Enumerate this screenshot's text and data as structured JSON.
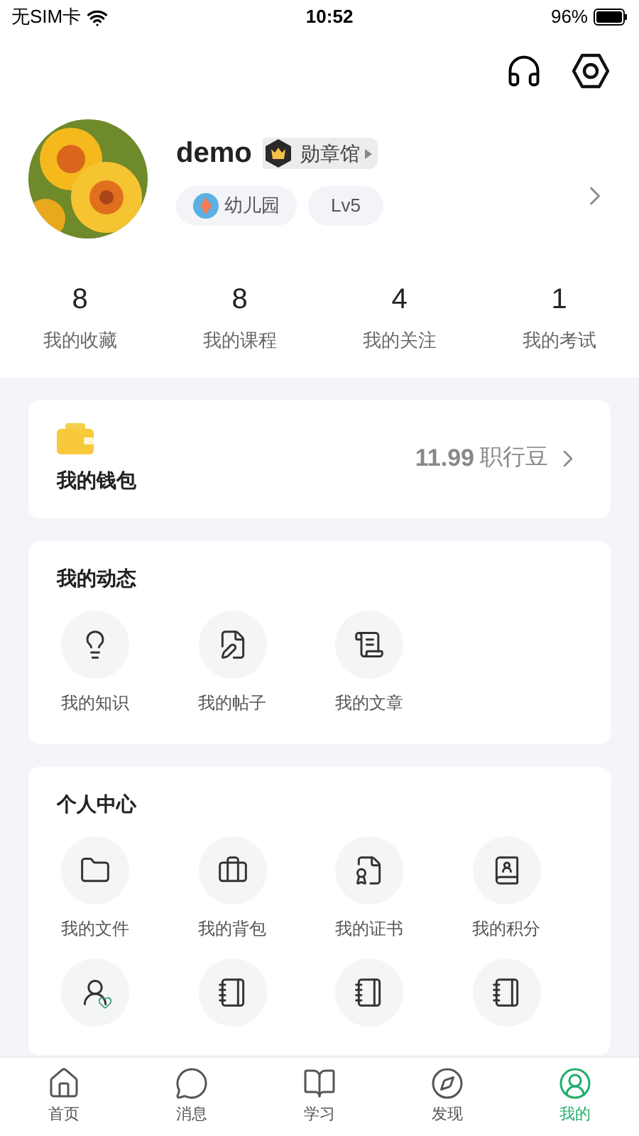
{
  "status_bar": {
    "carrier": "无SIM卡",
    "time": "10:52",
    "battery": "96%"
  },
  "profile": {
    "name": "demo",
    "badge": "勋章馆",
    "school": "幼儿园",
    "level": "Lv5"
  },
  "stats": [
    {
      "value": "8",
      "label": "我的收藏"
    },
    {
      "value": "8",
      "label": "我的课程"
    },
    {
      "value": "4",
      "label": "我的关注"
    },
    {
      "value": "1",
      "label": "我的考试"
    }
  ],
  "wallet": {
    "title": "我的钱包",
    "amount": "11.99",
    "unit": "职行豆"
  },
  "activity": {
    "title": "我的动态",
    "items": [
      {
        "kind": "knowledge",
        "label": "我的知识"
      },
      {
        "kind": "posts",
        "label": "我的帖子"
      },
      {
        "kind": "articles",
        "label": "我的文章"
      }
    ]
  },
  "personal_center": {
    "title": "个人中心",
    "items": [
      {
        "kind": "files",
        "label": "我的文件"
      },
      {
        "kind": "backpack",
        "label": "我的背包"
      },
      {
        "kind": "certificate",
        "label": "我的证书"
      },
      {
        "kind": "points",
        "label": "我的积分"
      }
    ]
  },
  "tab_bar": [
    {
      "kind": "home",
      "label": "首页",
      "selected": false
    },
    {
      "kind": "messages",
      "label": "消息",
      "selected": false
    },
    {
      "kind": "study",
      "label": "学习",
      "selected": false
    },
    {
      "kind": "discover",
      "label": "发现",
      "selected": false
    },
    {
      "kind": "me",
      "label": "我的",
      "selected": true
    }
  ]
}
